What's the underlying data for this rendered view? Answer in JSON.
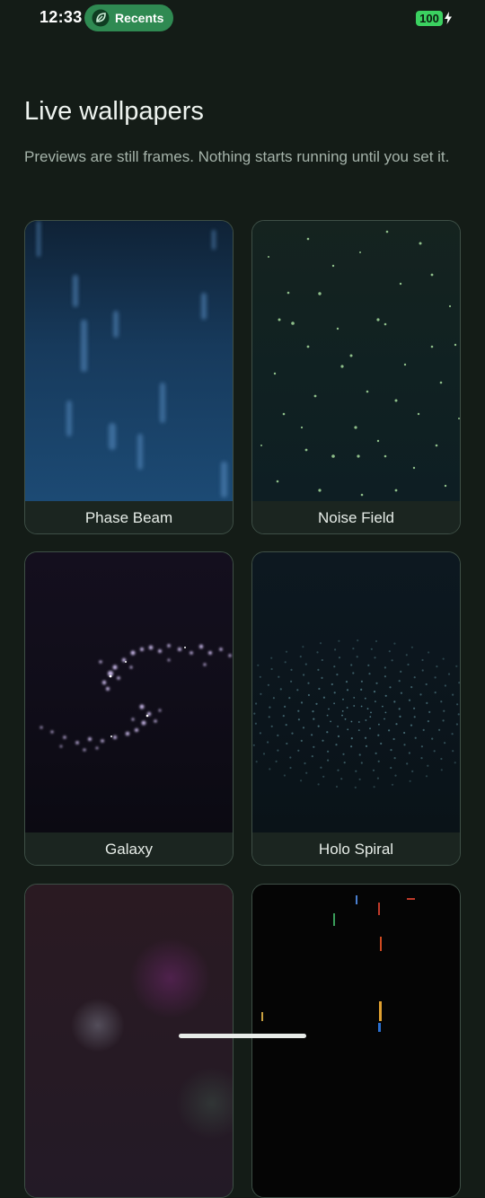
{
  "status_bar": {
    "time": "12:33",
    "recents_label": "Recents",
    "recents_icon": "leaf-icon",
    "battery_level": "100",
    "battery_charging": true,
    "accent_color": "#2f8a52",
    "battery_color": "#3bd160"
  },
  "page": {
    "title": "Live wallpapers",
    "subtitle": "Previews are still frames. Nothing starts running until you set it."
  },
  "wallpapers": [
    {
      "name": "Phase Beam"
    },
    {
      "name": "Noise Field"
    },
    {
      "name": "Galaxy"
    },
    {
      "name": "Holo Spiral"
    },
    {
      "name": ""
    },
    {
      "name": ""
    }
  ]
}
